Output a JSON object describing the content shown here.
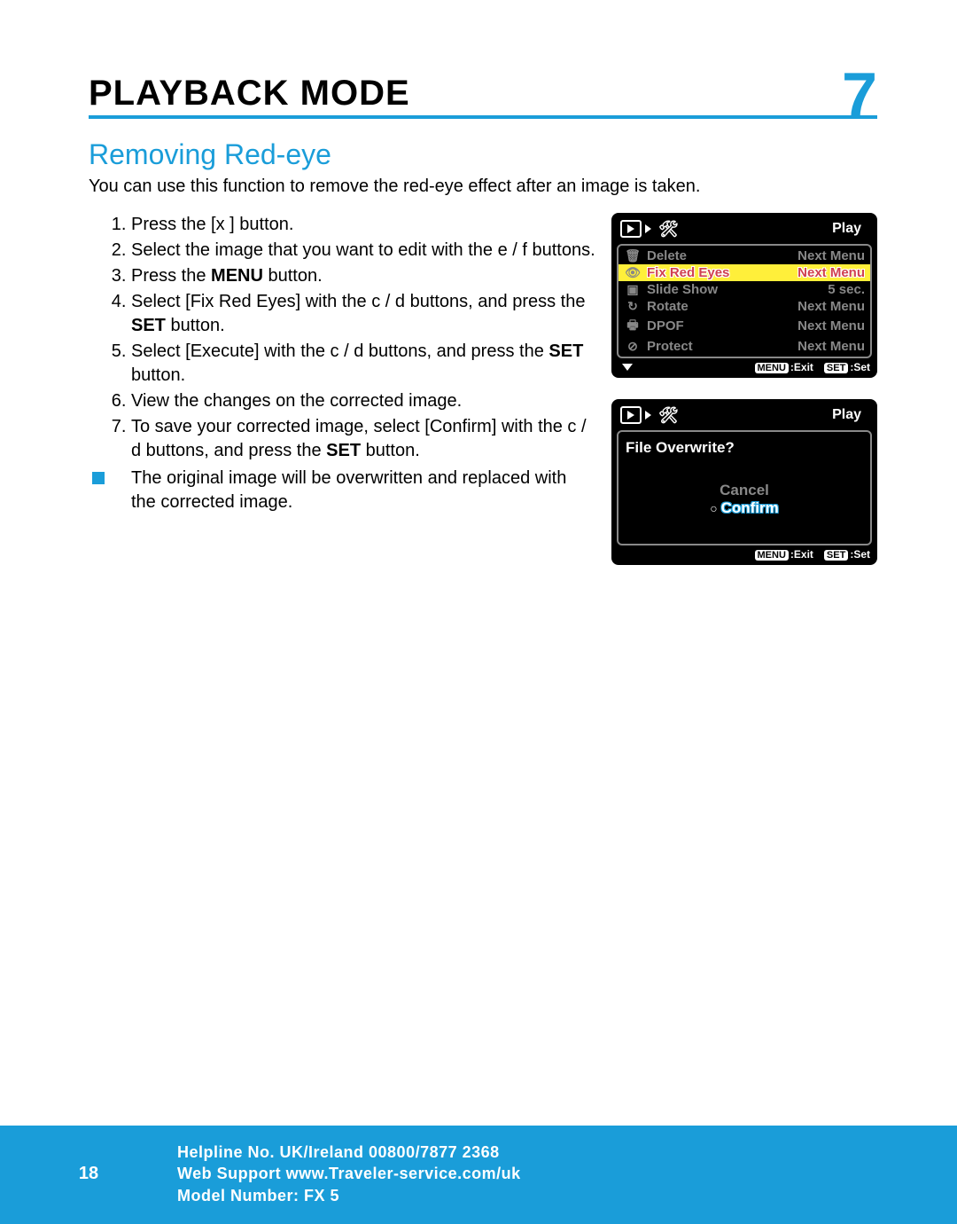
{
  "header": {
    "title": "PLAYBACK MODE",
    "chapter_num": "7"
  },
  "section": {
    "title": "Removing Red-eye",
    "intro": "You can use this function to remove the red-eye effect after an image is taken."
  },
  "steps": {
    "s1": "Press the [x ] button.",
    "s2": "Select the image that you want to edit with the  e /  f  buttons.",
    "s3a": "Press the ",
    "s3b": "MENU",
    "s3c": " button.",
    "s4a": "Select [Fix Red Eyes] with the  c /  d  buttons, and press the ",
    "s4b": "SET",
    "s4c": " button.",
    "s5a": "Select [Execute] with the  c /  d  buttons, and press the ",
    "s5b": "SET",
    "s5c": " button.",
    "s6": "View the changes on the corrected image.",
    "s7a": "To save your corrected image, select [Confirm] with the  c /  d  buttons, and press the ",
    "s7b": "SET",
    "s7c": " button."
  },
  "note": "The original image will be overwritten and replaced with the corrected image.",
  "lcd1": {
    "title": "Play",
    "rows": [
      {
        "icon": "🗑",
        "label": "Delete",
        "value": "Next Menu",
        "selected": false
      },
      {
        "icon": "👁",
        "label": "Fix Red Eyes",
        "value": "Next Menu",
        "selected": true
      },
      {
        "icon": "▣",
        "label": "Slide Show",
        "value": "5 sec.",
        "selected": false
      },
      {
        "icon": "↻",
        "label": "Rotate",
        "value": "Next Menu",
        "selected": false
      },
      {
        "icon": "🖶",
        "label": "DPOF",
        "value": "Next Menu",
        "selected": false
      },
      {
        "icon": "⊘",
        "label": "Protect",
        "value": "Next Menu",
        "selected": false
      }
    ],
    "exit": ":Exit",
    "set": ":Set",
    "menu_pill": "MENU",
    "set_pill": "SET"
  },
  "lcd2": {
    "title": "Play",
    "question": "File Overwrite?",
    "cancel": "Cancel",
    "confirm": "Confirm",
    "exit": ":Exit",
    "set": ":Set",
    "menu_pill": "MENU",
    "set_pill": "SET"
  },
  "footer": {
    "page": "18",
    "line1": "Helpline No. UK/Ireland 00800/7877 2368",
    "line2": "Web Support www.Traveler-service.com/uk",
    "line3": "Model Number: FX 5"
  }
}
